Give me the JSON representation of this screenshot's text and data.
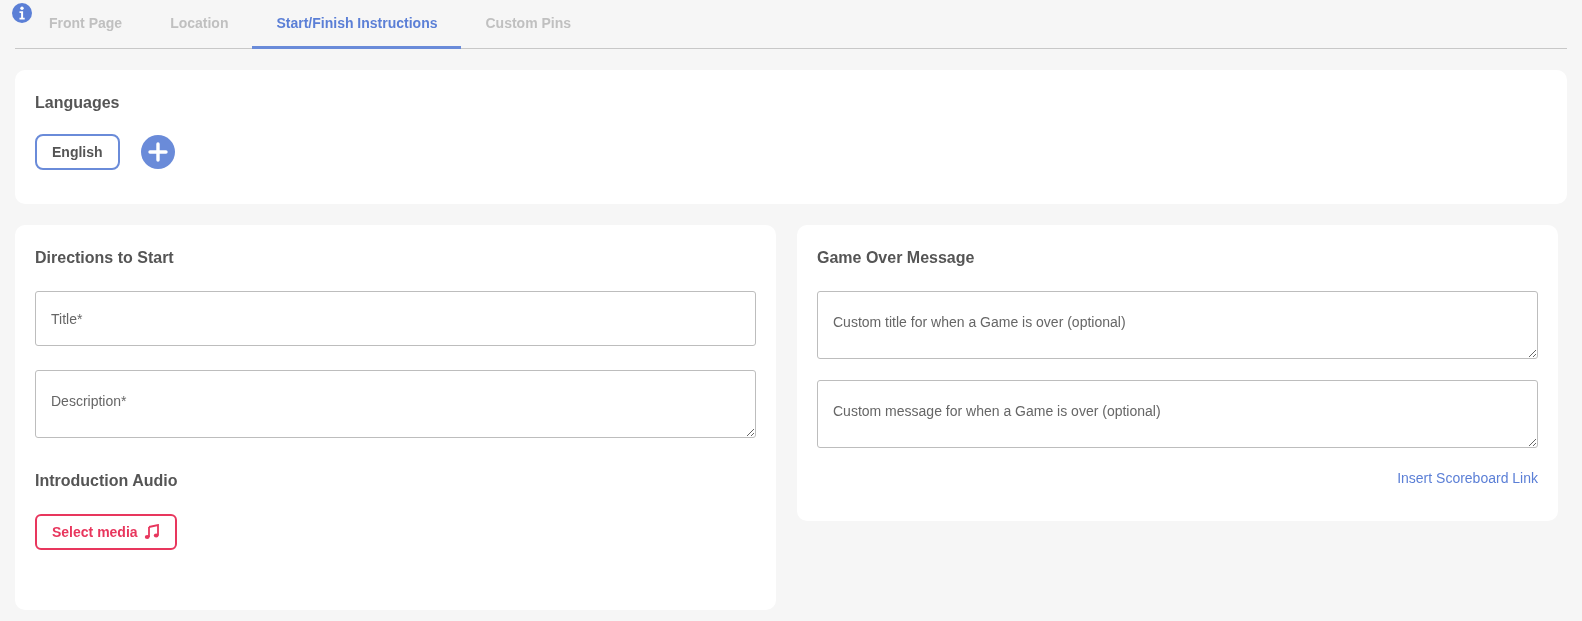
{
  "tabs": [
    {
      "label": "Front Page",
      "selected": false
    },
    {
      "label": "Location",
      "selected": false
    },
    {
      "label": "Start/Finish Instructions",
      "selected": true
    },
    {
      "label": "Custom Pins",
      "selected": false
    }
  ],
  "languages": {
    "heading": "Languages",
    "items": [
      {
        "label": "English",
        "selected": true
      }
    ]
  },
  "directions": {
    "heading": "Directions to Start",
    "fields": [
      {
        "kind": "input",
        "placeholder": "Title*"
      },
      {
        "kind": "textarea",
        "placeholder": "Description*"
      }
    ],
    "audio_heading": "Introduction Audio",
    "media_button": "Select media"
  },
  "game_over": {
    "heading": "Game Over Message",
    "fields": [
      {
        "kind": "textarea",
        "placeholder": "Custom title for when a Game is over (optional)"
      },
      {
        "kind": "textarea",
        "placeholder": "Custom message for when a Game is over (optional)"
      }
    ],
    "link": "Insert Scoreboard Link"
  }
}
